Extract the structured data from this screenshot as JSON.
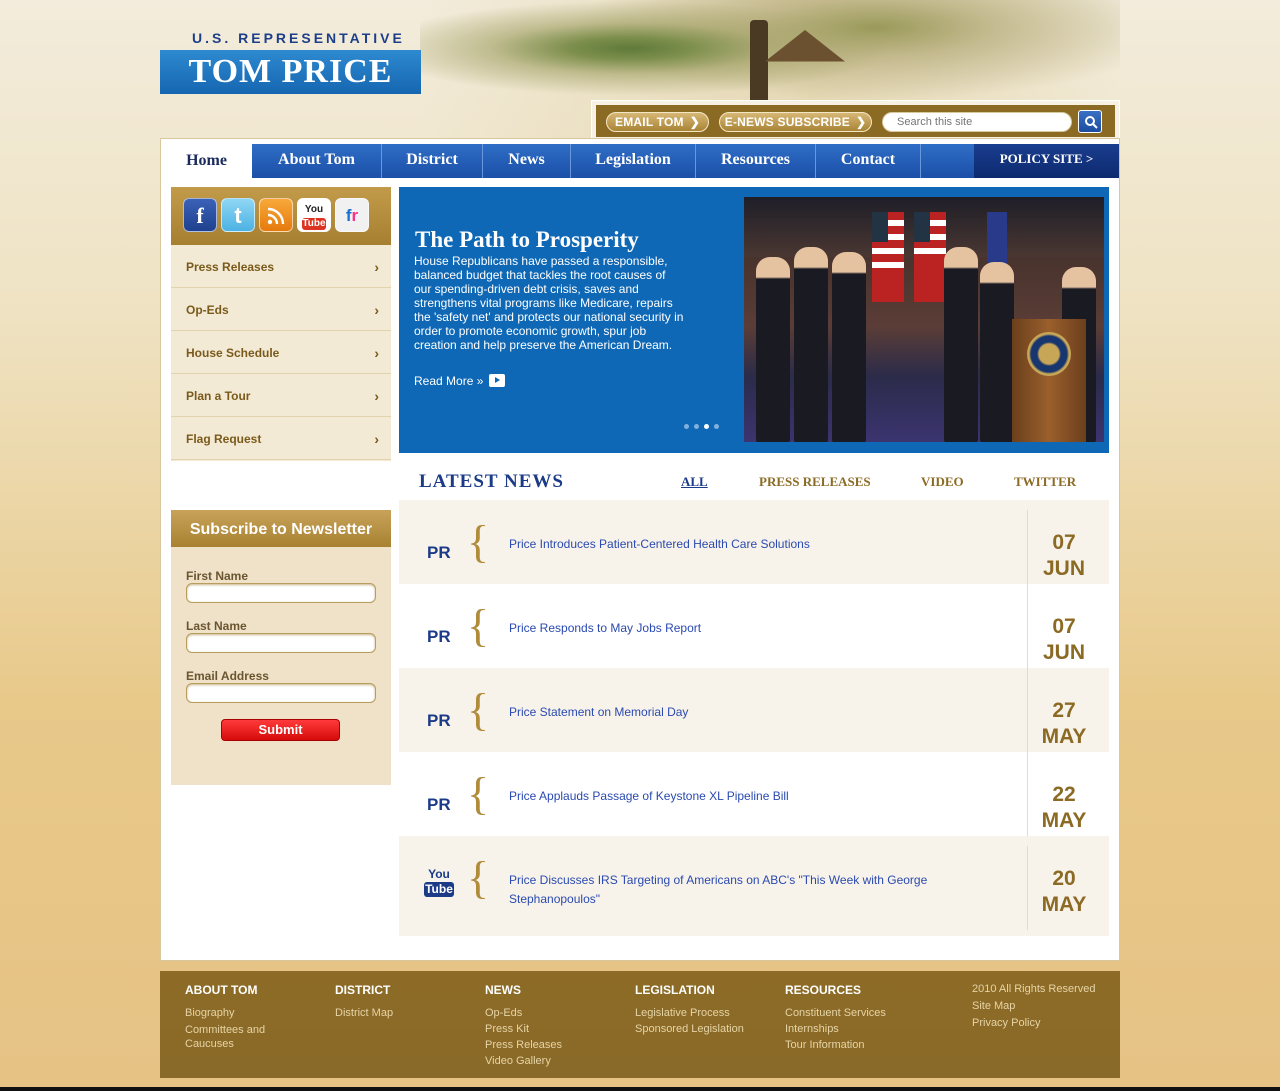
{
  "header": {
    "logo_top": "U.S. REPRESENTATIVE",
    "logo_main": "TOM PRICE",
    "email_btn": "EMAIL TOM",
    "enews_btn": "E-NEWS SUBSCRIBE",
    "search_placeholder": "Search this site"
  },
  "nav": {
    "home": "Home",
    "items": [
      "About Tom",
      "District",
      "News",
      "Legislation",
      "Resources",
      "Contact"
    ],
    "policy": "POLICY SITE >"
  },
  "social": {
    "facebook": "f",
    "twitter": "t",
    "youtube_you": "You",
    "youtube_tube": "Tube",
    "flickr_f": "f",
    "flickr_r": "r"
  },
  "sidebar": {
    "items": [
      "Press Releases",
      "Op-Eds",
      "House Schedule",
      "Plan a Tour",
      "Flag Request"
    ]
  },
  "newsletter": {
    "title": "Subscribe to Newsletter",
    "first_name": "First Name",
    "last_name": "Last Name",
    "email": "Email Address",
    "submit": "Submit"
  },
  "hero": {
    "title": "The Path to Prosperity",
    "text": "House Republicans have passed a responsible, balanced budget that tackles the root causes of our spending-driven debt crisis, saves and strengthens vital programs like Medicare, repairs the 'safety net' and protects our national security in order to promote economic growth, spur job creation and help preserve the American Dream.",
    "read_more": "Read More »",
    "slide_count": 4,
    "active_slide": 3
  },
  "latest_news": {
    "title": "LATEST NEWS",
    "tabs": [
      "ALL",
      "PRESS RELEASES",
      "VIDEO",
      "TWITTER"
    ],
    "active_tab": "ALL",
    "items": [
      {
        "tag": "PR",
        "title": "Price Introduces Patient-Centered Health Care Solutions",
        "day": "07",
        "month": "JUN"
      },
      {
        "tag": "PR",
        "title": "Price Responds to May Jobs Report",
        "day": "07",
        "month": "JUN"
      },
      {
        "tag": "PR",
        "title": "Price Statement on Memorial Day",
        "day": "27",
        "month": "MAY"
      },
      {
        "tag": "PR",
        "title": "Price Applauds Passage of Keystone XL Pipeline Bill",
        "day": "22",
        "month": "MAY"
      },
      {
        "tag_you": "You",
        "tag_tube": "Tube",
        "title": "Price Discusses IRS Targeting of Americans on ABC's \"This Week with George Stephanopoulos\"",
        "day": "20",
        "month": "MAY"
      }
    ]
  },
  "footer": {
    "columns": [
      {
        "title": "ABOUT TOM",
        "links": [
          "Biography",
          "Committees and Caucuses"
        ]
      },
      {
        "title": "DISTRICT",
        "links": [
          "District Map"
        ]
      },
      {
        "title": "NEWS",
        "links": [
          "Op-Eds",
          "Press Kit",
          "Press Releases",
          "Video Gallery"
        ]
      },
      {
        "title": "LEGISLATION",
        "links": [
          "Legislative Process",
          "Sponsored Legislation"
        ]
      },
      {
        "title": "RESOURCES",
        "links": [
          "Constituent Services",
          "Internships",
          "Tour Information"
        ]
      }
    ],
    "copyright": "2010 All Rights Reserved",
    "site_map": "Site Map",
    "privacy": "Privacy Policy"
  },
  "colors": {
    "accent_blue": "#0e68b6",
    "nav_blue": "#1b4fa8",
    "gold": "#8b6a24",
    "submit_red": "#e01010"
  }
}
